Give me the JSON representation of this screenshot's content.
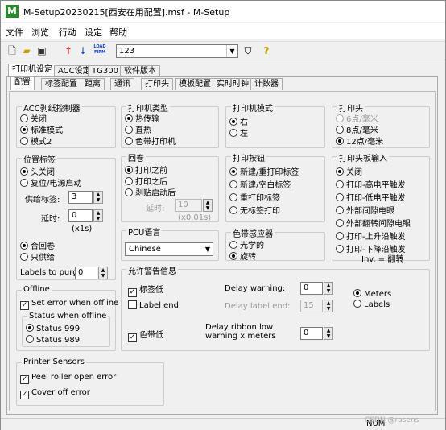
{
  "window": {
    "title": "M-Setup20230215[西安在用配置].msf - M-Setup",
    "app_icon": "M"
  },
  "menu": [
    "文件",
    "浏览",
    "行动",
    "设定",
    "帮助"
  ],
  "toolbar": {
    "printer_combo": "123",
    "icons": [
      "new-file-icon",
      "open-folder-icon",
      "save-disk-icon",
      "arrow-up-icon",
      "arrow-down-icon",
      "load-firm-icon",
      "filter-icon",
      "help-icon"
    ],
    "load_firm_label": "LOAD FIRM"
  },
  "top_tabs": [
    "打印机设定",
    "ACC设定",
    "TG300",
    "软件版本"
  ],
  "sub_tabs": [
    "配置",
    "标签配置",
    "距离",
    "通讯",
    "打印头",
    "模板配置",
    "实时时钟",
    "计数器"
  ],
  "acc": {
    "label": "ACC剥纸控制器",
    "options": [
      "关闭",
      "标准模式",
      "模式2"
    ],
    "selected": 1
  },
  "printer_type": {
    "label": "打印机类型",
    "options": [
      "热传输",
      "直热",
      "色带打印机"
    ],
    "selected": 0
  },
  "printer_mode": {
    "label": "打印机模式",
    "options": [
      "右",
      "左"
    ],
    "selected": 0
  },
  "print_head": {
    "label": "打印头",
    "options": [
      "6点/毫米",
      "8点/毫米",
      "12点/毫米"
    ],
    "selected": 2
  },
  "position_label": {
    "label": "位置标签",
    "options": [
      "头关闭",
      "复位/电源启动"
    ],
    "selected": 0,
    "feed_label": "供给标签:",
    "feed_value": "3",
    "delay_label": "延时:",
    "delay_value": "0",
    "delay_unit": "(x1s)",
    "rewind_options": [
      "合回卷",
      "只供给"
    ],
    "rewind_selected": 0,
    "purge_label": "Labels to purge:",
    "purge_value": "0"
  },
  "rewind": {
    "label": "回卷",
    "options": [
      "打印之前",
      "打印之后",
      "剥贴启动后"
    ],
    "selected": 0,
    "delay_label": "延时:",
    "delay_value": "10",
    "delay_unit": "(x0,01s)"
  },
  "print_button": {
    "label": "打印按钮",
    "options": [
      "新建/重打印标签",
      "新建/空白标签",
      "重打印标签",
      "无标签打印"
    ],
    "selected": 0
  },
  "head_input": {
    "label": "打印头板输入",
    "options": [
      "关闭",
      "打印-高电平触发",
      "打印-低电平触发",
      "外部间隙电眼",
      "外部翻转间隙电眼",
      "打印-上升沿触发",
      "打印-下降沿触发"
    ],
    "selected": 0,
    "inv_text": "Inv. = 翻转"
  },
  "pcu": {
    "label": "PCU语言",
    "value": "Chinese"
  },
  "ribbon_sensor": {
    "label": "色带感应器",
    "options": [
      "光学的",
      "旋转"
    ],
    "selected": 1
  },
  "offline": {
    "label": "Offline",
    "set_error": "Set error when offline",
    "set_error_checked": true,
    "status_label": "Status when offline",
    "status_options": [
      "Status 999",
      "Status 989"
    ],
    "status_selected": 0
  },
  "warning": {
    "label": "允许警告信息",
    "label_low": "标签低",
    "label_low_checked": true,
    "label_end": "Label end",
    "label_end_checked": false,
    "delay_warning": "Delay warning:",
    "delay_warning_value": "0",
    "delay_label_end": "Delay label end:",
    "delay_label_end_value": "15",
    "unit_options": [
      "Meters",
      "Labels"
    ],
    "unit_selected": 0,
    "ribbon_low": "色带低",
    "ribbon_low_checked": true,
    "delay_ribbon": "Delay ribbon low warning x meters",
    "delay_ribbon_value": "0"
  },
  "sensors": {
    "label": "Printer Sensors",
    "peel": "Peel roller open error",
    "peel_checked": true,
    "cover": "Cover off error",
    "cover_checked": true
  },
  "status": {
    "num": "NUM",
    "watermark": "CSDN @rasens"
  }
}
